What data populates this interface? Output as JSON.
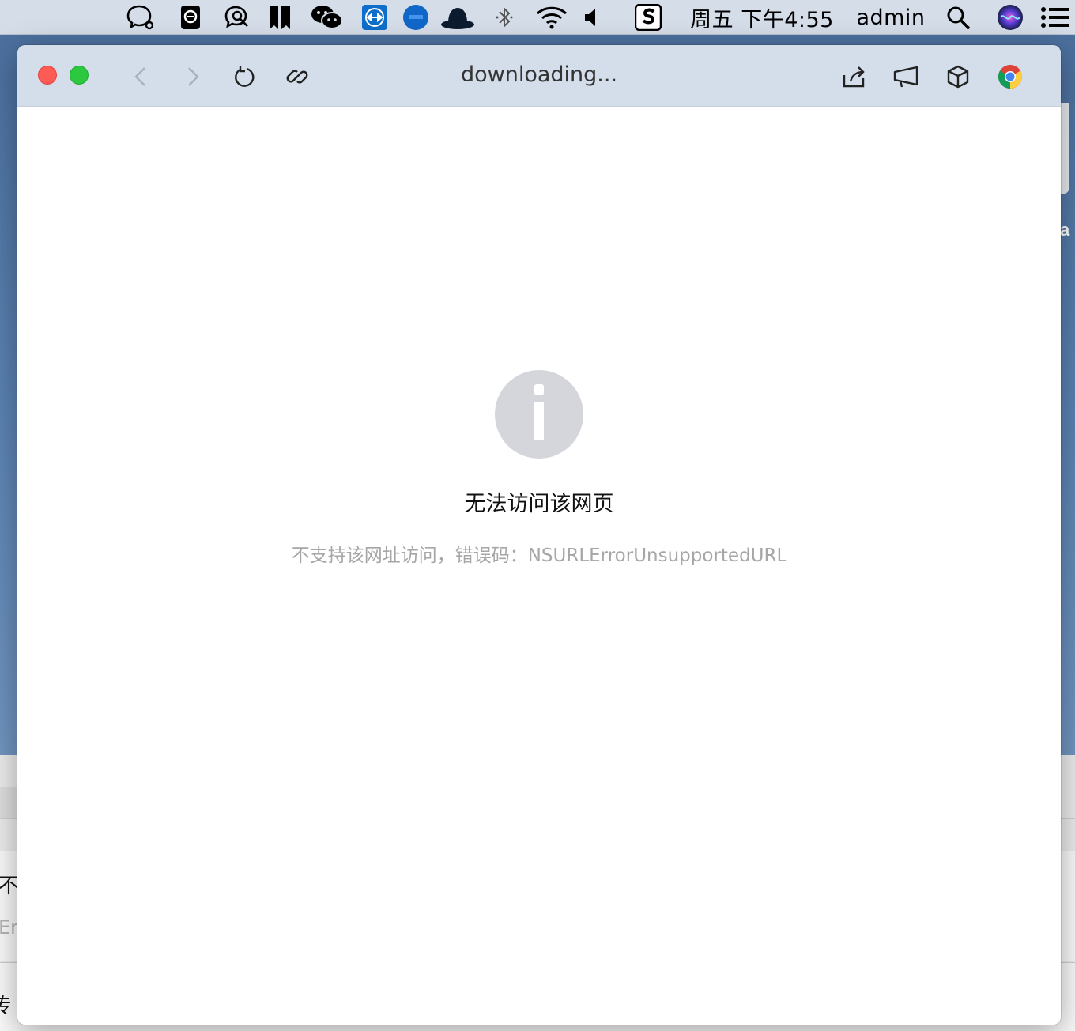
{
  "menubar": {
    "clock": "周五 下午4:55",
    "user": "admin",
    "icons": [
      "chat-bubble-icon",
      "e-app-icon",
      "search-bubble-icon",
      "bookmark-app-icon",
      "wechat-icon",
      "teamviewer-icon",
      "blue-circle-app-icon",
      "hat-icon",
      "bluetooth-icon",
      "wifi-icon",
      "volume-icon",
      "s-app-icon",
      "spotlight-icon",
      "siri-icon",
      "control-list-icon"
    ]
  },
  "window": {
    "title": "downloading...",
    "toolbar_icons": [
      "back-icon",
      "forward-icon",
      "reload-icon",
      "link-icon",
      "share-icon",
      "announce-icon",
      "cube-icon",
      "chrome-icon"
    ]
  },
  "error": {
    "title": "无法访问该网页",
    "message": "不支持该网址访问，错误码：NSURLErrorUnsupportedURL"
  },
  "background_window": {
    "char1": "不",
    "char2": "Er",
    "char3": "传",
    "side_letter": "a"
  },
  "colors": {
    "close": "#fd5b54",
    "zoom": "#2bc840",
    "titlebar": "#d4deea",
    "info_icon": "#d4d6db"
  }
}
